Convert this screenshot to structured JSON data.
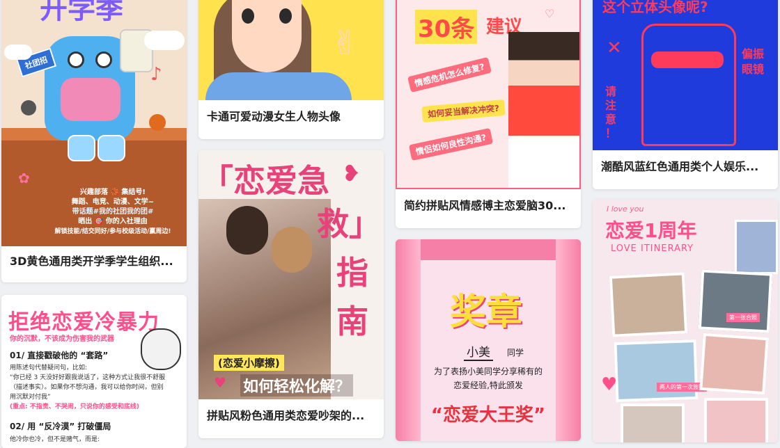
{
  "cards": [
    {
      "title": "3D黄色通用类开学季学生组织...",
      "thumb": {
        "heading": "开学季",
        "badge": "社团招",
        "lines": [
          "兴趣部落 🏀 集结号!",
          "舞蹈、电竞、动漫、文学~",
          "带话题#我的社团我的团#",
          "晒出 🎯 你的入社理由",
          "解锁技能/结交同好/参与校级活动/赢周边!"
        ]
      }
    },
    {
      "title": "拒绝恋爱冷暴力",
      "thumb": {
        "heading": "拒绝恋爱冷暴力",
        "sub": "你的沉默，不该成为伤害我的武器",
        "s1_title": "01/ 直接戳破他的 “套路”",
        "s1_body1": "用陈述句代替疑问句，比如:",
        "s1_body2": "“你已经 3 天没好好跟我说话了，这种方式让我很不舒服",
        "s1_body3": "（描述事实）。如果你不想沟通，我可以给你时间，但别",
        "s1_body4": "用沉默对付我”",
        "s1_note": "(重点: 不指责、不哭闹，只说你的感受和底线)",
        "s2_title": "02/ 用 “反冷漠” 打破僵局",
        "s2_body1": "他冷你也冷，但不是赌气，而是:"
      }
    },
    {
      "title": "卡通可爱动漫女生人物头像",
      "thumb": {}
    },
    {
      "title": "拼贴风粉色通用类恋爱吵架的...",
      "thumb": {
        "big1": "「恋爱急",
        "big2": "救」",
        "big3": "指",
        "big4": "南",
        "tag": "(恋爱小摩擦)",
        "sub": "如何轻松化解？"
      }
    },
    {
      "title": "简约拼贴风情感博主恋爱脑30...",
      "thumb": {
        "heading1": "30条",
        "heading2": "建议",
        "q1": "情感危机怎么修复?",
        "q2": "如何妥当解决冲突?",
        "q3": "情侣如何良性沟通?"
      }
    },
    {
      "title": "",
      "thumb": {
        "heading": "奖章",
        "name": "小美",
        "suffix": "同学",
        "line1": "为了表扬小美同学分享稀有的",
        "line2": "恋爱经验,特此颁发",
        "award": "“恋爱大王奖”"
      }
    },
    {
      "title": "潮酷风蓝红色通用类个人娱乐...",
      "thumb": {
        "heading": "这个立体头像呢?",
        "side1": "偏振",
        "side2": "眼镜",
        "left1": "请",
        "left2": "注",
        "left3": "意",
        "left4": "！"
      }
    },
    {
      "title": "",
      "thumb": {
        "small": "I love you",
        "heading": "恋爱1周年",
        "sub": "LOVE ITINERARY",
        "cap1": "第一张合照",
        "cap2": "两人的第一次旅行"
      }
    }
  ],
  "colors": {
    "pink": "#ff4f8a",
    "hotpink": "#e8427a",
    "blue": "#1f3bdc",
    "red": "#ff3b3b",
    "yellow": "#ffe34d"
  }
}
